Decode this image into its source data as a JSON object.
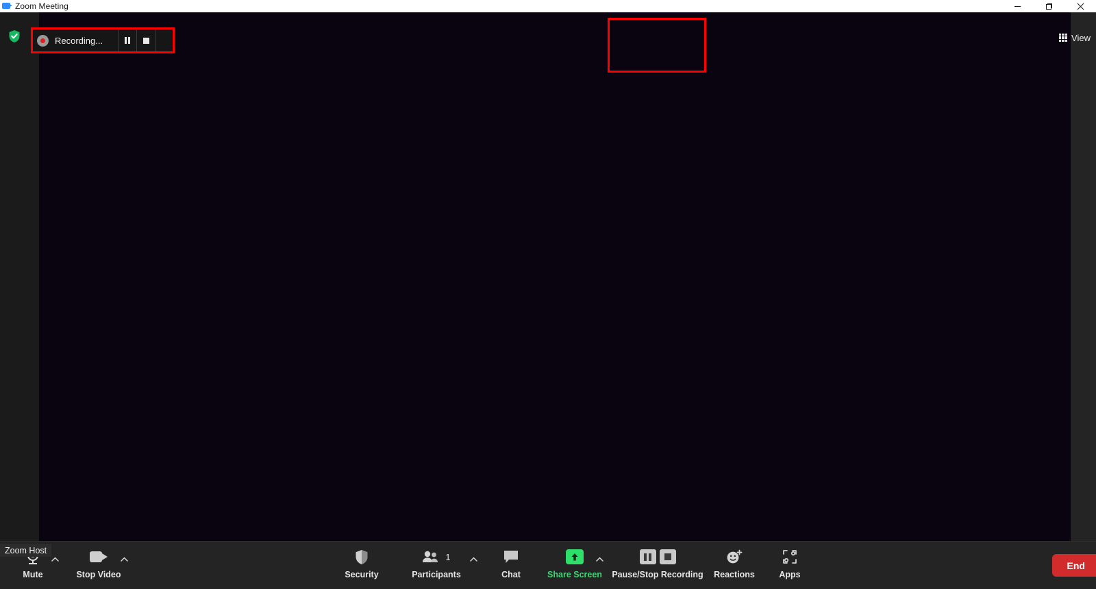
{
  "window": {
    "title": "Zoom Meeting",
    "app_icon": "zoom-camera-icon",
    "controls": {
      "minimize": "minimize-icon",
      "maximize": "maximize-icon",
      "close": "close-icon"
    }
  },
  "stage": {
    "encryption_icon": "green-shield-check-icon",
    "background_color": "#0a0411",
    "name_tag": "Zoom Host",
    "view_button": {
      "label": "View",
      "icon": "grid-view-icon"
    }
  },
  "recording_indicator": {
    "status_label": "Recording...",
    "dot_icon": "recording-dot-icon",
    "pause_icon": "pause-icon",
    "stop_icon": "stop-icon",
    "highlight_color": "#ff0000"
  },
  "toolbar": {
    "items": [
      {
        "id": "mute",
        "label": "Mute",
        "icon": "microphone-icon",
        "has_caret": true
      },
      {
        "id": "stop-video",
        "label": "Stop Video",
        "icon": "video-camera-icon",
        "has_caret": true
      },
      {
        "id": "security",
        "label": "Security",
        "icon": "shield-icon",
        "has_caret": false
      },
      {
        "id": "participants",
        "label": "Participants",
        "icon": "people-icon",
        "count": "1",
        "has_caret": true
      },
      {
        "id": "chat",
        "label": "Chat",
        "icon": "chat-bubble-icon",
        "has_caret": false
      },
      {
        "id": "share-screen",
        "label": "Share Screen",
        "icon": "share-arrow-up-icon",
        "has_caret": true,
        "accent": "#2ee06a"
      },
      {
        "id": "pause-stop-recording",
        "label": "Pause/Stop Recording",
        "icon": "pause-stop-icon",
        "has_caret": false,
        "highlighted": true
      },
      {
        "id": "reactions",
        "label": "Reactions",
        "icon": "smiley-plus-icon",
        "has_caret": false
      },
      {
        "id": "apps",
        "label": "Apps",
        "icon": "apps-bracket-icon",
        "has_caret": false
      }
    ],
    "end_button": {
      "label": "End",
      "color": "#d22b2b"
    }
  }
}
